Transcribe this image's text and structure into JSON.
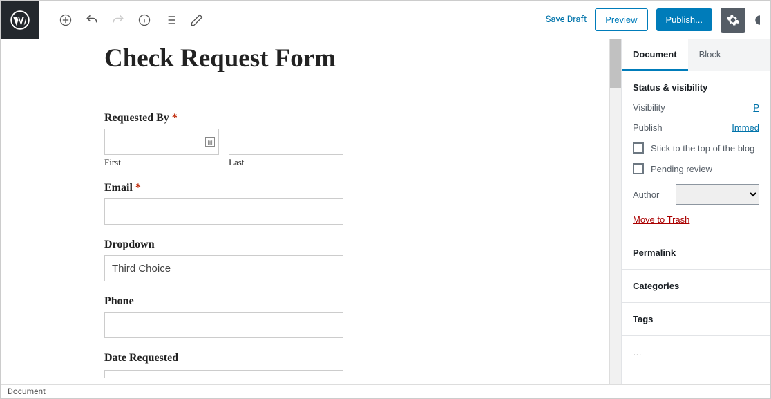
{
  "topbar": {
    "save_draft": "Save Draft",
    "preview": "Preview",
    "publish": "Publish..."
  },
  "editor": {
    "title": "Check Request Form",
    "fields": {
      "requested_by": {
        "label": "Requested By",
        "required": "*",
        "first_sub": "First",
        "last_sub": "Last"
      },
      "email": {
        "label": "Email",
        "required": "*"
      },
      "dropdown": {
        "label": "Dropdown",
        "value": "Third Choice"
      },
      "phone": {
        "label": "Phone"
      },
      "date_requested": {
        "label": "Date Requested"
      }
    }
  },
  "sidebar": {
    "tabs": {
      "document": "Document",
      "block": "Block"
    },
    "status": {
      "title": "Status & visibility",
      "visibility_label": "Visibility",
      "visibility_value": "P",
      "publish_label": "Publish",
      "publish_value": "Immed",
      "stick": "Stick to the top of the blog",
      "pending": "Pending review",
      "author_label": "Author",
      "trash": "Move to Trash"
    },
    "permalink": "Permalink",
    "categories": "Categories",
    "tags": "Tags"
  },
  "statusbar": {
    "text": "Document"
  }
}
